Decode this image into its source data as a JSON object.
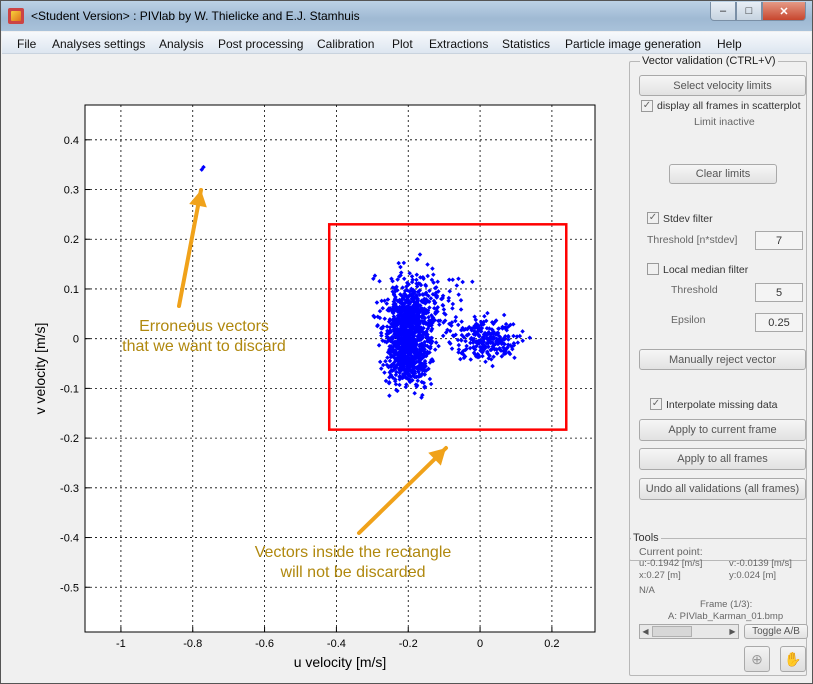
{
  "window": {
    "title": "<Student Version> : PIVlab by W. Thielicke and E.J. Stamhuis",
    "buttons": {
      "minimize": "–",
      "maximize": "□",
      "close": "✕"
    }
  },
  "menu": {
    "items": [
      "File",
      "Analyses settings",
      "Analysis",
      "Post processing",
      "Calibration",
      "Plot",
      "Extractions",
      "Statistics",
      "Particle image generation",
      "Help"
    ]
  },
  "chart_data": {
    "type": "scatter",
    "xlabel": "u velocity [m/s]",
    "ylabel": "v velocity [m/s]",
    "xlim": [
      -1.1,
      0.32
    ],
    "ylim": [
      -0.59,
      0.47
    ],
    "xticks": [
      -1,
      -0.8,
      -0.6,
      -0.4,
      -0.2,
      0,
      0.2
    ],
    "yticks": [
      0.4,
      0.3,
      0.2,
      0.1,
      0,
      -0.1,
      -0.2,
      -0.3,
      -0.4,
      -0.5
    ],
    "grid": true,
    "marker_color": "#0000ff",
    "series": [
      {
        "outliers": [
          [
            -0.77,
            0.345
          ],
          [
            -0.775,
            0.34
          ]
        ],
        "main_cluster_center": [
          -0.2,
          0.0
        ],
        "main_cluster_extent_u": [
          -0.31,
          0.14
        ],
        "main_cluster_extent_v": [
          -0.15,
          0.2
        ]
      }
    ],
    "limit_rectangle": {
      "u": [
        -0.42,
        0.24
      ],
      "v": [
        -0.183,
        0.23
      ],
      "color": "#ff0000"
    }
  },
  "annotations": {
    "erroneous_line1": "Erroneous vectors",
    "erroneous_line2": "that we want to discard",
    "inside_line1": "Vectors inside the rectangle",
    "inside_line2": "will not be discarded",
    "color": "#b0880e",
    "arrow_color": "#f0a21a"
  },
  "panel": {
    "vector_validation": {
      "title": "Vector validation (CTRL+V)",
      "select_velocity_limits": "Select velocity limits",
      "display_all_frames": "display all frames in scatterplot",
      "limit_status": "Limit inactive",
      "clear_limits": "Clear limits",
      "stdev_filter": "Stdev filter",
      "stdev_threshold_label": "Threshold [n*stdev]",
      "stdev_threshold_value": "7",
      "local_median_filter": "Local median filter",
      "median_threshold_label": "Threshold",
      "median_threshold_value": "5",
      "epsilon_label": "Epsilon",
      "epsilon_value": "0.25",
      "manually_reject": "Manually reject  vector",
      "interpolate_missing": "Interpolate missing data",
      "apply_current": "Apply to current frame",
      "apply_all": "Apply to all frames",
      "undo_all": "Undo all validations (all frames)"
    },
    "tools": {
      "title": "Tools",
      "current_point": "Current point:",
      "u": "u:-0.1942 [m/s]",
      "v": "v:-0.0139 [m/s]",
      "x": "x:0.27 [m]",
      "y": "y:0.024 [m]",
      "na": "N/A",
      "frame": "Frame (1/3):",
      "file": "A: PIVlab_Karman_01.bmp",
      "toggle": "Toggle A/B"
    }
  }
}
